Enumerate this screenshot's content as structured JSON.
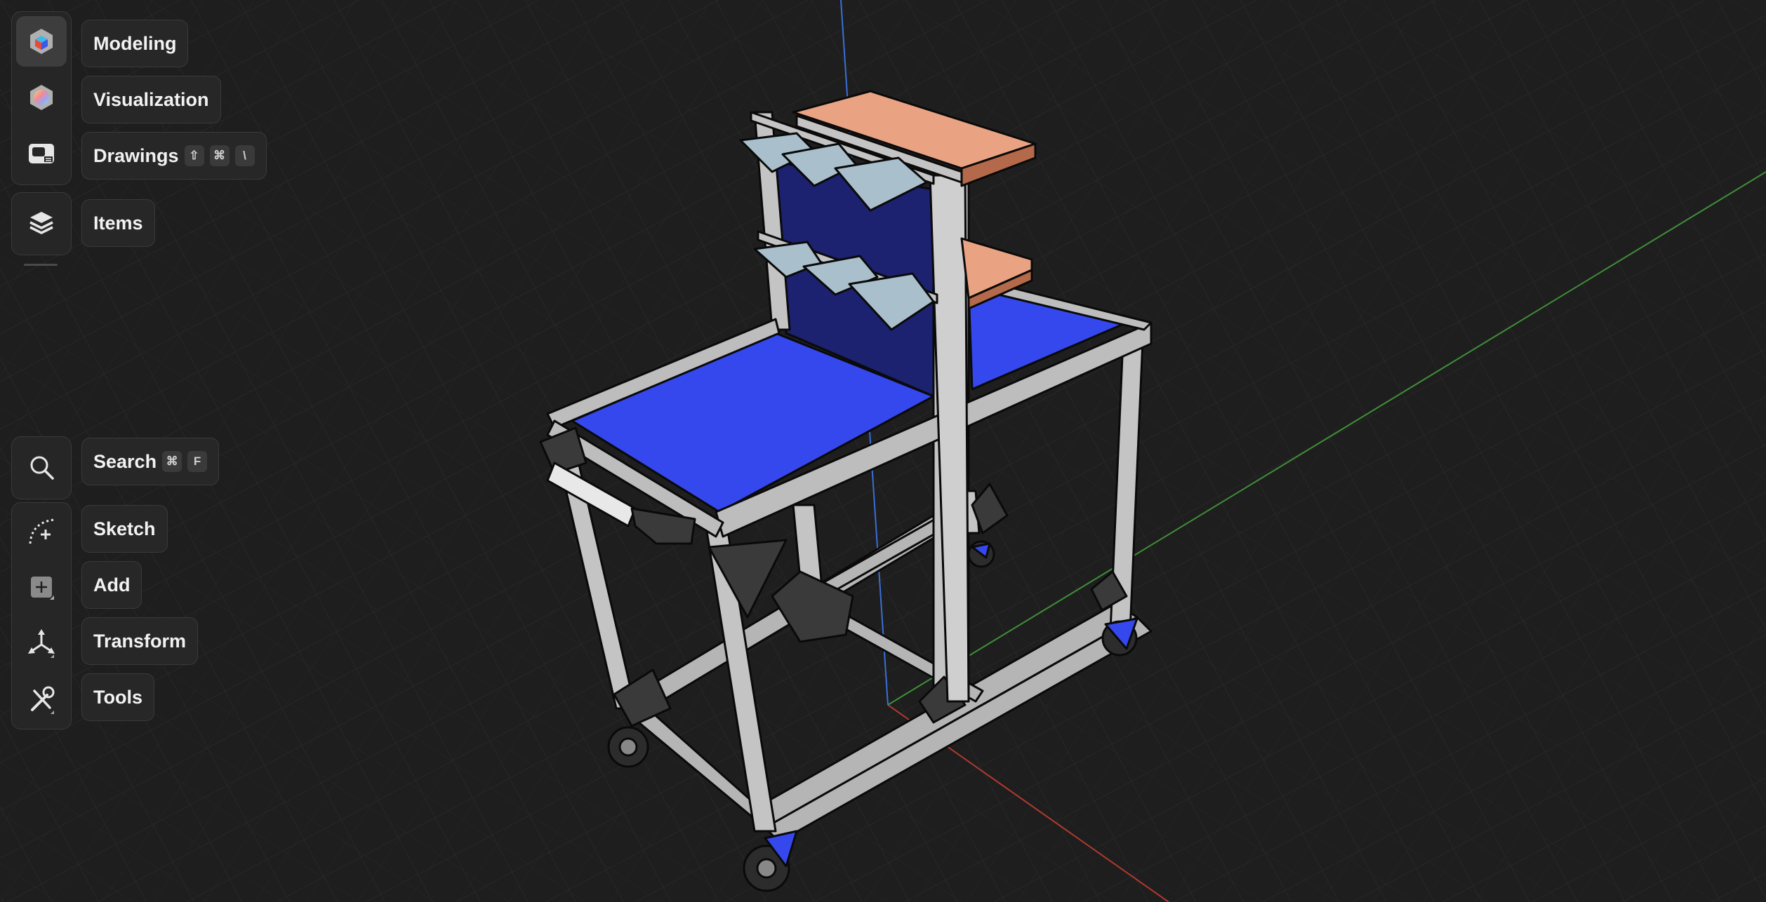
{
  "workspace": {
    "modeling_label": "Modeling",
    "visualization_label": "Visualization",
    "drawings_label": "Drawings",
    "drawings_shortcut": [
      "⇧",
      "⌘",
      "\\"
    ],
    "items_label": "Items"
  },
  "toolbar": {
    "search_label": "Search",
    "search_shortcut": [
      "⌘",
      "F"
    ],
    "sketch_label": "Sketch",
    "add_label": "Add",
    "transform_label": "Transform",
    "tools_label": "Tools"
  },
  "colors": {
    "background": "#1e1e1e",
    "grid": "#2a2a2a",
    "axis_x": "#b03a2e",
    "axis_y": "#3f8f3a",
    "axis_z": "#3a6fd8",
    "tabletop": "#3448ee",
    "backboard": "#1c2170",
    "tray": "#e9a383",
    "bin": "#a9c0cc",
    "frame": "#b5b5b5"
  },
  "icons": {
    "modeling": "modeling-cube-icon",
    "visualization": "visualization-icon",
    "drawings": "drawings-icon",
    "items": "layers-icon",
    "search": "search-icon",
    "sketch": "sketch-icon",
    "add": "add-icon",
    "transform": "transform-icon",
    "tools": "tools-icon"
  }
}
